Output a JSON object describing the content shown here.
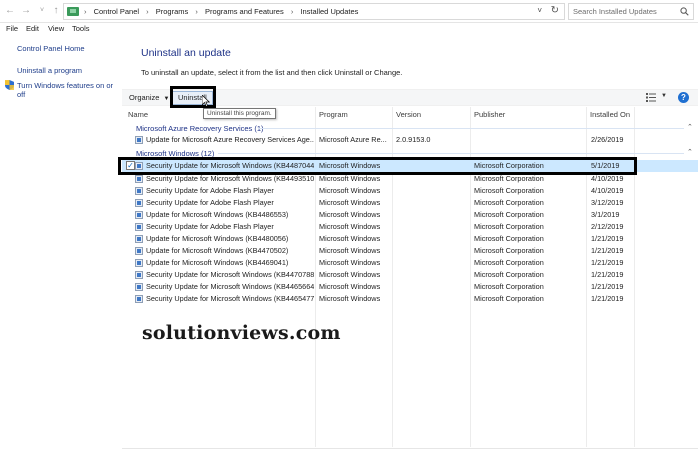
{
  "address_bar": {
    "crumbs": [
      "Control Panel",
      "Programs",
      "Programs and Features",
      "Installed Updates"
    ],
    "search_placeholder": "Search Installed Updates"
  },
  "menu": [
    "File",
    "Edit",
    "View",
    "Tools"
  ],
  "left_pane": {
    "home": "Control Panel Home",
    "uninstall_program": "Uninstall a program",
    "features_line1": "Turn Windows features on or",
    "features_line2": "off"
  },
  "main": {
    "title": "Uninstall an update",
    "subtitle": "To uninstall an update, select it from the list and then click Uninstall or Change."
  },
  "toolbar": {
    "organize": "Organize",
    "uninstall": "Uninstall",
    "tooltip": "Uninstall this program."
  },
  "columns": [
    "Name",
    "Program",
    "Version",
    "Publisher",
    "Installed On"
  ],
  "groups": [
    {
      "title": "Microsoft Azure Recovery Services (1)",
      "rows": [
        {
          "name": "Update for Microsoft Azure Recovery Services Age...",
          "program": "Microsoft Azure Re...",
          "version": "2.0.9153.0",
          "publisher": "",
          "installed": "2/26/2019"
        }
      ]
    },
    {
      "title": "Microsoft Windows (12)",
      "rows": [
        {
          "name": "Security Update for Microsoft Windows (KB4487044)",
          "program": "Microsoft Windows",
          "version": "",
          "publisher": "Microsoft Corporation",
          "installed": "5/1/2019"
        },
        {
          "name": "Security Update for Microsoft Windows (KB4493510)",
          "program": "Microsoft Windows",
          "version": "",
          "publisher": "Microsoft Corporation",
          "installed": "4/10/2019"
        },
        {
          "name": "Security Update for Adobe Flash Player",
          "program": "Microsoft Windows",
          "version": "",
          "publisher": "Microsoft Corporation",
          "installed": "4/10/2019"
        },
        {
          "name": "Security Update for Adobe Flash Player",
          "program": "Microsoft Windows",
          "version": "",
          "publisher": "Microsoft Corporation",
          "installed": "3/12/2019"
        },
        {
          "name": "Update for Microsoft Windows (KB4486553)",
          "program": "Microsoft Windows",
          "version": "",
          "publisher": "Microsoft Corporation",
          "installed": "3/1/2019"
        },
        {
          "name": "Security Update for Adobe Flash Player",
          "program": "Microsoft Windows",
          "version": "",
          "publisher": "Microsoft Corporation",
          "installed": "2/12/2019"
        },
        {
          "name": "Update for Microsoft Windows (KB4480056)",
          "program": "Microsoft Windows",
          "version": "",
          "publisher": "Microsoft Corporation",
          "installed": "1/21/2019"
        },
        {
          "name": "Update for Microsoft Windows (KB4470502)",
          "program": "Microsoft Windows",
          "version": "",
          "publisher": "Microsoft Corporation",
          "installed": "1/21/2019"
        },
        {
          "name": "Update for Microsoft Windows (KB4469041)",
          "program": "Microsoft Windows",
          "version": "",
          "publisher": "Microsoft Corporation",
          "installed": "1/21/2019"
        },
        {
          "name": "Security Update for Microsoft Windows (KB4470788)",
          "program": "Microsoft Windows",
          "version": "",
          "publisher": "Microsoft Corporation",
          "installed": "1/21/2019"
        },
        {
          "name": "Security Update for Microsoft Windows (KB4465664)",
          "program": "Microsoft Windows",
          "version": "",
          "publisher": "Microsoft Corporation",
          "installed": "1/21/2019"
        },
        {
          "name": "Security Update for Microsoft Windows (KB4465477)",
          "program": "Microsoft Windows",
          "version": "",
          "publisher": "Microsoft Corporation",
          "installed": "1/21/2019"
        }
      ]
    }
  ],
  "watermark": "solutionviews.com",
  "colors": {
    "link": "#1e3d8a",
    "heading": "#1e3287",
    "selection": "#cce8ff",
    "highlight_box": "#000000"
  }
}
